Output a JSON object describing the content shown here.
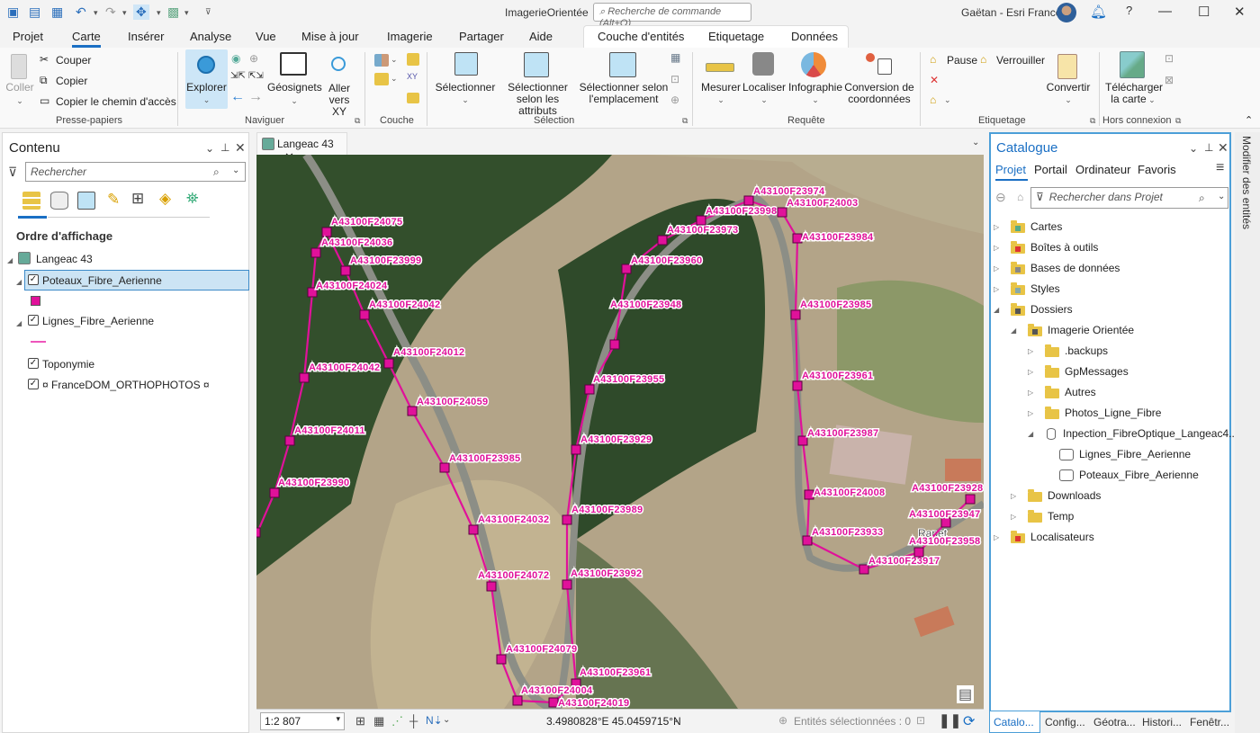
{
  "titlebar": {
    "app_title": "ImagerieOrientée",
    "command_search_placeholder": "Recherche de commande (Alt+Q)",
    "user": "Gaëtan - Esri France",
    "help": "?",
    "minimize": "—",
    "maximize": "☐",
    "close": "✕"
  },
  "tabs": [
    "Projet",
    "Carte",
    "Insérer",
    "Analyse",
    "Vue",
    "Mise à jour",
    "Imagerie",
    "Partager",
    "Aide"
  ],
  "active_tab": "Carte",
  "contextual_tabs": [
    "Couche d'entités",
    "Etiquetage",
    "Données"
  ],
  "ribbon": {
    "clipboard": {
      "paste": "Coller",
      "cut": "Couper",
      "copy": "Copier",
      "copy_path": "Copier le chemin d'accès",
      "group": "Presse-papiers"
    },
    "navigate": {
      "explore": "Explorer",
      "bookmarks": "Géosignets",
      "goto_xy_1": "Aller",
      "goto_xy_2": "vers XY",
      "group": "Naviguer"
    },
    "layer": {
      "group": "Couche"
    },
    "selection": {
      "select": "Sélectionner",
      "by_attr_1": "Sélectionner",
      "by_attr_2": "selon les attributs",
      "by_loc_1": "Sélectionner selon",
      "by_loc_2": "l'emplacement",
      "group": "Sélection"
    },
    "inquiry": {
      "measure": "Mesurer",
      "locate": "Localiser",
      "infographics": "Infographie",
      "convert_1": "Conversion de",
      "convert_2": "coordonnées",
      "group": "Requête"
    },
    "labeling": {
      "pause": "Pause",
      "lock": "Verrouiller",
      "convert": "Convertir",
      "group": "Etiquetage"
    },
    "offline": {
      "download_1": "Télécharger",
      "download_2": "la carte",
      "group": "Hors connexion"
    }
  },
  "contents": {
    "title": "Contenu",
    "search_placeholder": "Rechercher",
    "section": "Ordre d'affichage",
    "map": "Langeac 43",
    "layers": [
      {
        "name": "Poteaux_Fibre_Aerienne",
        "checked": true,
        "selected": true
      },
      {
        "name": "Lignes_Fibre_Aerienne",
        "checked": true
      },
      {
        "name": "Toponymie",
        "checked": true
      },
      {
        "name": "¤ FranceDOM_ORTHOPHOTOS ¤",
        "checked": true
      }
    ]
  },
  "map": {
    "tab_label": "Langeac 43",
    "scale": "1:2 807",
    "coordinates": "3.4980828°E 45.0459715°N",
    "selected_features": "Entités sélectionnées : 0",
    "place_label": "Rapet",
    "feature_color": "#e0119a",
    "poles": [
      {
        "id": "A43100F24075"
      },
      {
        "id": "A43100F24036"
      },
      {
        "id": "A43100F23999"
      },
      {
        "id": "A43100F24024"
      },
      {
        "id": "A43100F24042"
      },
      {
        "id": "A43100F24012"
      },
      {
        "id": "A43100F24042"
      },
      {
        "id": "A43100F24059"
      },
      {
        "id": "A43100F24011"
      },
      {
        "id": "A43100F23985"
      },
      {
        "id": "A43100F23990"
      },
      {
        "id": "A43100F24032"
      },
      {
        "id": "A43100F24072"
      },
      {
        "id": "A43100F23992"
      },
      {
        "id": "A43100F24079"
      },
      {
        "id": "A43100F23961"
      },
      {
        "id": "A43100F24004"
      },
      {
        "id": "A43100F24019"
      },
      {
        "id": "A43100F23989"
      },
      {
        "id": "A43100F23929"
      },
      {
        "id": "A43100F23955"
      },
      {
        "id": "A43100F23948"
      },
      {
        "id": "A43100F23960"
      },
      {
        "id": "A43100F23973"
      },
      {
        "id": "A43100F23998"
      },
      {
        "id": "A43100F23974"
      },
      {
        "id": "A43100F24003"
      },
      {
        "id": "A43100F23984"
      },
      {
        "id": "A43100F23985"
      },
      {
        "id": "A43100F23961"
      },
      {
        "id": "A43100F23987"
      },
      {
        "id": "A43100F24008"
      },
      {
        "id": "A43100F23933"
      },
      {
        "id": "A43100F23917"
      },
      {
        "id": "A43100F23958"
      },
      {
        "id": "A43100F23947"
      },
      {
        "id": "A43100F23928"
      }
    ]
  },
  "catalog": {
    "title": "Catalogue",
    "tabs": [
      "Projet",
      "Portail",
      "Ordinateur",
      "Favoris"
    ],
    "search_placeholder": "Rechercher dans Projet",
    "items": [
      {
        "label": "Cartes"
      },
      {
        "label": "Boîtes à outils"
      },
      {
        "label": "Bases de données"
      },
      {
        "label": "Styles"
      },
      {
        "label": "Dossiers"
      },
      {
        "label": "Imagerie Orientée"
      },
      {
        "label": ".backups"
      },
      {
        "label": "GpMessages"
      },
      {
        "label": "Autres"
      },
      {
        "label": "Photos_Ligne_Fibre"
      },
      {
        "label": "Inpection_FibreOptique_Langeac4..."
      },
      {
        "label": "Lignes_Fibre_Aerienne"
      },
      {
        "label": "Poteaux_Fibre_Aerienne"
      },
      {
        "label": "Downloads"
      },
      {
        "label": "Temp"
      },
      {
        "label": "Localisateurs"
      }
    ],
    "bottom_tabs": [
      "Catalo...",
      "Config...",
      "Géotra...",
      "Histori...",
      "Fenêtr..."
    ]
  },
  "side_tab": "Modifier des entités"
}
